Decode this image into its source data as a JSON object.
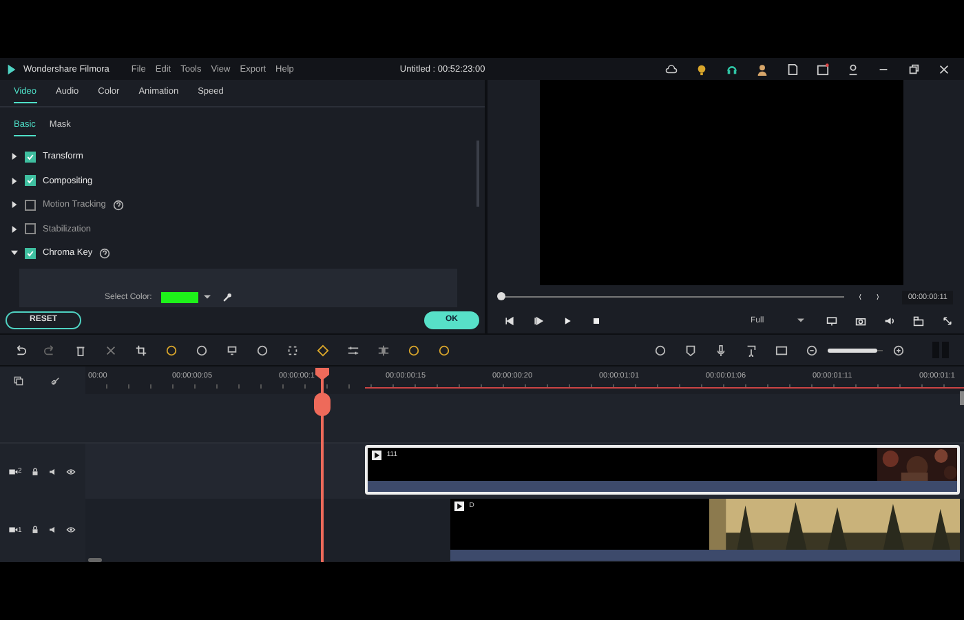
{
  "app": {
    "name": "Wondershare Filmora",
    "menu": [
      "File",
      "Edit",
      "Tools",
      "View",
      "Export",
      "Help"
    ],
    "title": "Untitled : 00:52:23:00"
  },
  "tabs": [
    {
      "label": "Video",
      "selected": true
    },
    {
      "label": "Audio",
      "selected": false
    },
    {
      "label": "Color",
      "selected": false
    },
    {
      "label": "Animation",
      "selected": false
    },
    {
      "label": "Speed",
      "selected": false
    }
  ],
  "subtabs": [
    {
      "label": "Basic",
      "selected": true
    },
    {
      "label": "Mask",
      "selected": false
    }
  ],
  "sections": [
    {
      "label": "Transform",
      "checked": true,
      "expanded": false,
      "help": false
    },
    {
      "label": "Compositing",
      "checked": true,
      "expanded": false,
      "help": false
    },
    {
      "label": "Motion Tracking",
      "checked": false,
      "expanded": false,
      "help": true
    },
    {
      "label": "Stabilization",
      "checked": false,
      "expanded": false,
      "help": false
    },
    {
      "label": "Chroma Key",
      "checked": true,
      "expanded": true,
      "help": true
    }
  ],
  "chroma": {
    "label": "Select Color:",
    "color": "#1ef21a"
  },
  "buttons": {
    "reset": "RESET",
    "ok": "OK"
  },
  "preview": {
    "scrubber": {
      "level": 0.0
    },
    "time": "00:00:00:11",
    "quality": "Full"
  },
  "zoom": {
    "level": 0.9
  },
  "timeline": {
    "ruler": [
      "00:00",
      "00:00:00:05",
      "00:00:00:1",
      "00:00:00:15",
      "00:00:00:20",
      "00:00:01:01",
      "00:00:01:06",
      "00:00:01:11",
      "00:00:01:1"
    ],
    "playhead": {
      "level": 0.27
    },
    "tracks": [
      {
        "number": "2",
        "clip": {
          "label": "111",
          "selected": true
        }
      },
      {
        "number": "1",
        "clip": {
          "label": "D",
          "selected": false
        }
      }
    ]
  }
}
